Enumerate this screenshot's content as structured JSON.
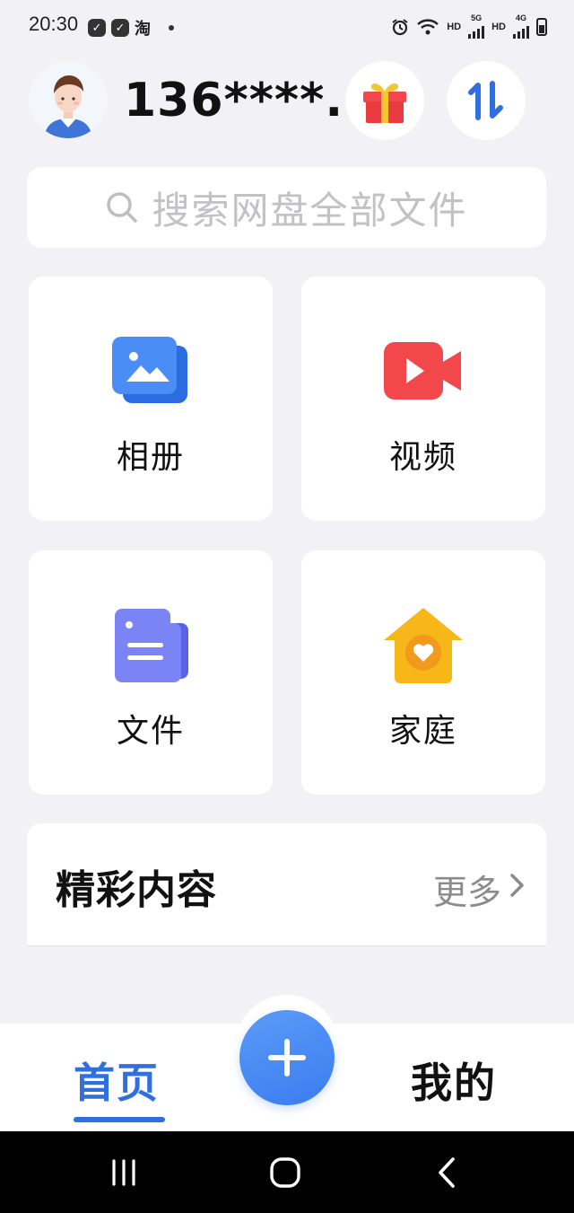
{
  "status_bar": {
    "time": "20:30",
    "app_char": "淘",
    "network_labels": [
      "HD",
      "5G",
      "HD",
      "4G"
    ]
  },
  "header": {
    "username": "136****...",
    "gift_icon": "gift-icon",
    "transfer_icon": "transfer-arrows-icon"
  },
  "search": {
    "placeholder": "搜索网盘全部文件",
    "icon": "search-icon"
  },
  "grid": [
    {
      "label": "相册",
      "icon": "album-icon",
      "color": "#3f83f4"
    },
    {
      "label": "视频",
      "icon": "video-icon",
      "color": "#f2484b"
    },
    {
      "label": "文件",
      "icon": "file-icon",
      "color": "#6d77f0"
    },
    {
      "label": "家庭",
      "icon": "family-home-icon",
      "color": "#f7b718"
    }
  ],
  "featured": {
    "title": "精彩内容",
    "more": "更多"
  },
  "tabs": {
    "home": "首页",
    "mine": "我的",
    "active": "home"
  },
  "colors": {
    "accent": "#2f6fe0",
    "background": "#f2f2f6"
  }
}
